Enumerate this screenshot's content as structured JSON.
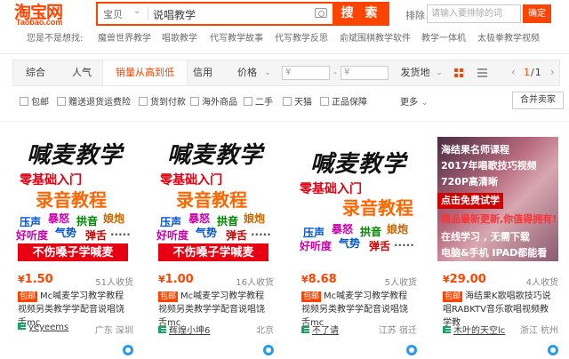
{
  "header": {
    "logo_cn": "淘宝网",
    "logo_en": "Taobao.com",
    "search_category": "宝贝",
    "search_value": "说唱教学",
    "search_button": "搜 索",
    "exclude_label": "排除",
    "exclude_placeholder": "请输入要排除的词",
    "exclude_button": "确定"
  },
  "suggestions": {
    "label": "您是不是想找:",
    "items": [
      "魔兽世界教学",
      "唱歌教学",
      "代写教学故事",
      "代写教学反思",
      "俞斌围棋教学软件",
      "教学一体机",
      "太极拳教学视频"
    ]
  },
  "sortbar": {
    "items": [
      "综合",
      "人气",
      "销量从高到低",
      "信用",
      "价格"
    ],
    "active_index": 2,
    "price_from": "¥",
    "price_to": "¥",
    "price_sep": "-",
    "ship_from": "发货地",
    "page_current": "1",
    "page_total": "/1"
  },
  "filters": {
    "items": [
      "包邮",
      "赠送退货运费险",
      "货到付款",
      "海外商品",
      "二手",
      "天猫",
      "正品保障"
    ],
    "more": "更多",
    "merge": "合并卖家"
  },
  "products": [
    {
      "price_symbol": "¥",
      "price": "1.50",
      "sales": "51人收货",
      "badge": "包邮",
      "desc": "Mc喊麦学习教学教程视频另类教学学配音说唱饶舌mc",
      "shop": "yeyeems",
      "location": "广东 深圳",
      "thumb": {
        "title": "喊麦教学",
        "sub1": "零基础入门",
        "sub2": "录音教程",
        "words": [
          "压声",
          "暴怒",
          "拱音",
          "娘炮",
          "好听度",
          "气势",
          "弹舌",
          "....."
        ],
        "banner": "不伤嗓子学喊麦"
      }
    },
    {
      "price_symbol": "¥",
      "price": "1.00",
      "sales": "16人收货",
      "badge": "包邮",
      "desc": "Mc喊麦学习教学教程视频另类教学学配音说唱饶舌mc",
      "shop": "辉煌小坤6",
      "location": "北京",
      "thumb": {
        "title": "喊麦教学",
        "sub1": "零基础入门",
        "sub2": "录音教程",
        "words": [
          "压声",
          "暴怒",
          "拱音",
          "娘炮",
          "好听度",
          "气势",
          "弹舌",
          "....."
        ],
        "banner": "不伤嗓子学喊麦"
      }
    },
    {
      "price_symbol": "¥",
      "price": "8.68",
      "sales": "5人收货",
      "badge": "包邮",
      "desc": "Mc喊麦学习教学教程视频另类教学学配音说唱饶舌mc",
      "shop": "不了请",
      "location": "江苏 宿迁",
      "thumb": {
        "title": "喊麦教学",
        "sub1": "零基础入门",
        "sub2": "录音教程",
        "words": [
          "压声",
          "暴怒",
          "拱音",
          "娘炮",
          "好听度",
          "气势",
          "弹舌",
          "....."
        ]
      }
    },
    {
      "price_symbol": "¥",
      "price": "29.00",
      "sales": "4人收货",
      "badge": "包邮",
      "desc": "海结果K歌唱歌技巧说唱RABKTV音乐歌唱视频教学教",
      "shop": "木叶的天空lc",
      "location": "浙江 杭州",
      "thumb": {
        "line1": "海结果名师课程",
        "line2": "2017年唱歌技巧视频",
        "line3": "720P高清晰",
        "banner": "点击免费试学",
        "highlight": "精品最新更新,你值得拥有!",
        "line4": "在线学习 , 无需下载",
        "line5": "电脑&手机 IPAD都能看"
      }
    }
  ],
  "colors": {
    "accent": "#ff4400",
    "banner_red": "#e60012",
    "orange": "#ff6600"
  }
}
